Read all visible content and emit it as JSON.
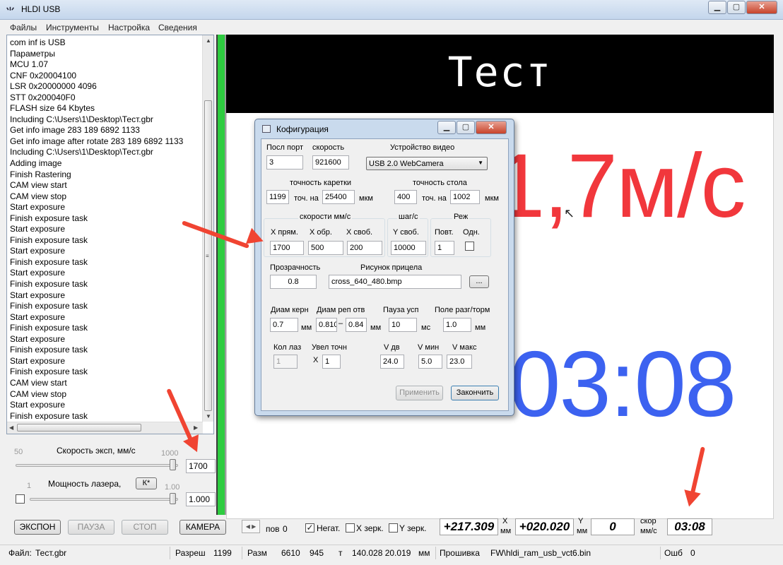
{
  "window": {
    "title": "HLDI USB",
    "buttons": [
      "▭",
      "▫",
      "✕"
    ]
  },
  "menu": [
    "Файлы",
    "Инструменты",
    "Настройка",
    "Сведения"
  ],
  "log": [
    "com inf is USB",
    "Параметры",
    "MCU 1.07",
    "CNF 0x20004100",
    "LSR 0x20000000 4096",
    "STT 0x200040F0",
    "FLASH size 64 Kbytes",
    "Including C:\\Users\\1\\Desktop\\Тест.gbr",
    "Get info image 283 189 6892 1133",
    "Get info image after rotate 283 189 6892 1133",
    "Including C:\\Users\\1\\Desktop\\Тест.gbr",
    "Adding image",
    "Finish Rastering",
    "CAM view start",
    "CAM view stop",
    "Start exposure",
    "Finish exposure task",
    "Start exposure",
    "Finish exposure task",
    "Start exposure",
    "Finish exposure task",
    "Start exposure",
    "Finish exposure task",
    "Start exposure",
    "Finish exposure task",
    "Start exposure",
    "Finish exposure task",
    "Start exposure",
    "Finish exposure task",
    "Start exposure",
    "Finish exposure task",
    "CAM view start",
    "CAM view stop",
    "Start exposure",
    "Finish exposure task"
  ],
  "controls": {
    "speed": {
      "label": "Скорость эксп, мм/с",
      "min": "50",
      "max": "1000",
      "value": "1700"
    },
    "laser": {
      "label": "Мощность лазера,",
      "k_button": "К*",
      "min": "1",
      "max": "1.00",
      "value": "1.000"
    }
  },
  "display": {
    "title": "Тест",
    "speed_overlay": "1,7м/с",
    "time_overlay": "03:08"
  },
  "dialog": {
    "title": "Кофигурация",
    "port_label": "Посл порт",
    "port": "3",
    "baud_label": "скорость",
    "baud": "921600",
    "video_label": "Устройство видео",
    "video": "USB 2.0 WebCamera",
    "carriage_label": "точность каретки",
    "carriage_steps": "1199",
    "carriage_on": "точ. на",
    "carriage_um": "25400",
    "carriage_unit": "мкм",
    "table_label": "точность стола",
    "table_steps": "400",
    "table_on": "точ. на",
    "table_um": "1002",
    "table_unit": "мкм",
    "speeds_group": "скорости мм/с",
    "x_fwd_label": "X прям.",
    "x_fwd": "1700",
    "x_back_label": "X обр.",
    "x_back": "500",
    "x_free_label": "X своб.",
    "x_free": "200",
    "step_group": "шаг/с",
    "y_free_label": "Y своб.",
    "y_free": "10000",
    "mode_group": "Реж",
    "repeat_label": "Повт.",
    "repeat": "1",
    "single_label": "Одн.",
    "transparency_label": "Прозрачность",
    "transparency": "0.8",
    "crosshair_label": "Рисунок прицела",
    "crosshair": "cross_640_480.bmp",
    "browse": "...",
    "core_label": "Диам керн",
    "core": "0.7",
    "core_unit": "мм",
    "hole_label": "Диам реп отв",
    "hole_a": "0.810",
    "hole_sep": "–",
    "hole_b": "0.84",
    "hole_unit": "мм",
    "pause_label": "Пауза усп",
    "pause": "10",
    "pause_unit": "мс",
    "accel_label": "Поле разг/торм",
    "accel": "1.0",
    "accel_unit": "мм",
    "laser_count_label": "Кол лаз",
    "laser_count": "1",
    "zoom_label": "Увел точн",
    "zoom_x": "X",
    "zoom": "1",
    "vdv_label": "V дв",
    "vdv": "24.0",
    "vmin_label": "V мин",
    "vmin": "5.0",
    "vmax_label": "V макс",
    "vmax": "23.0",
    "apply": "Применить",
    "finish": "Закончить"
  },
  "toolbar": {
    "expose": "ЭКСПОН",
    "pause": "ПАУЗА",
    "stop": "СТОП",
    "camera": "КАМЕРА",
    "pos_label": "пов",
    "pos_value": "0",
    "negative": "Негат.",
    "x_mirror": "X зерк.",
    "y_mirror": "Y зерк.",
    "x_value": "+217.309",
    "x_axis": "X",
    "x_unit": "мм",
    "y_value": "+020.020",
    "y_axis": "Y",
    "y_unit": "мм",
    "speed_value": "0",
    "speed_label": "скор",
    "speed_unit": "мм/с",
    "time_value": "03:08"
  },
  "status": {
    "file_label": "Файл:",
    "file": "Тест.gbr",
    "res_label": "Разреш",
    "res": "1199",
    "size_label": "Разм",
    "size_w": "6610",
    "size_h": "945",
    "t_label": "т",
    "dims": "140.028 20.019",
    "dims_unit": "мм",
    "firmware_label": "Прошивка",
    "firmware": "FW\\hldi_ram_usb_vct6.bin",
    "err_label": "Ошб",
    "err": "0"
  },
  "colors": {
    "speed_overlay": "#f1373c",
    "time_overlay": "#3c62f0",
    "annotation_arrow": "#f04432",
    "progress_green": "#2ecc40"
  }
}
